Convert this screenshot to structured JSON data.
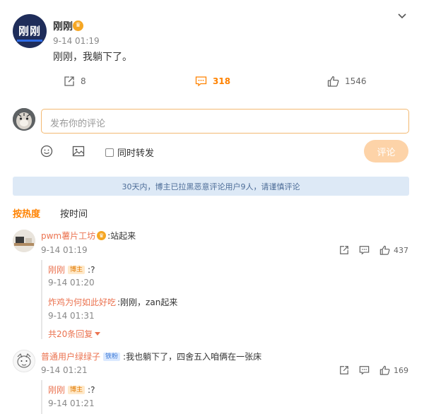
{
  "post": {
    "author": "刚刚",
    "author_avatar_text": "刚刚",
    "author_badge_icon": "vip-crown-icon",
    "time": "9-14 01:19",
    "text": "刚刚，我躺下了。",
    "share_count": "8",
    "comment_count": "318",
    "like_count": "1546"
  },
  "composer": {
    "placeholder": "发布你的评论",
    "repost_label": "同时转发",
    "submit_label": "评论"
  },
  "notice": "30天内，博主已拉黑恶意评论用户9人，请谨慎评论",
  "sort": {
    "hot_label": "按热度",
    "time_label": "按时间"
  },
  "comments": [
    {
      "user": "pwm薯片工坊",
      "text": ":站起来",
      "time": "9-14 01:19",
      "like_count": "437",
      "replies": [
        {
          "user": "刚刚",
          "tag": "博主",
          "text": ":?",
          "time": "9-14 01:20"
        },
        {
          "user": "炸鸡为何如此好吃",
          "text": ":刚刚，zan起来",
          "time": "9-14 01:31"
        }
      ],
      "more_replies": "共20条回复"
    },
    {
      "user": "普通用户绿绿子",
      "tag": "铁粉",
      "text": ":我也躺下了，四舍五入咱俩在一张床",
      "time": "9-14 01:21",
      "like_count": "169",
      "replies": [
        {
          "user": "刚刚",
          "tag": "博主",
          "text": ":?",
          "time": "9-14 01:21"
        }
      ]
    }
  ],
  "colors": {
    "accent": "#ff8200",
    "username": "#eb7350",
    "notice_bg": "#dde9f6",
    "input_border": "#f3b972",
    "submit_bg": "#fdd3a8"
  }
}
